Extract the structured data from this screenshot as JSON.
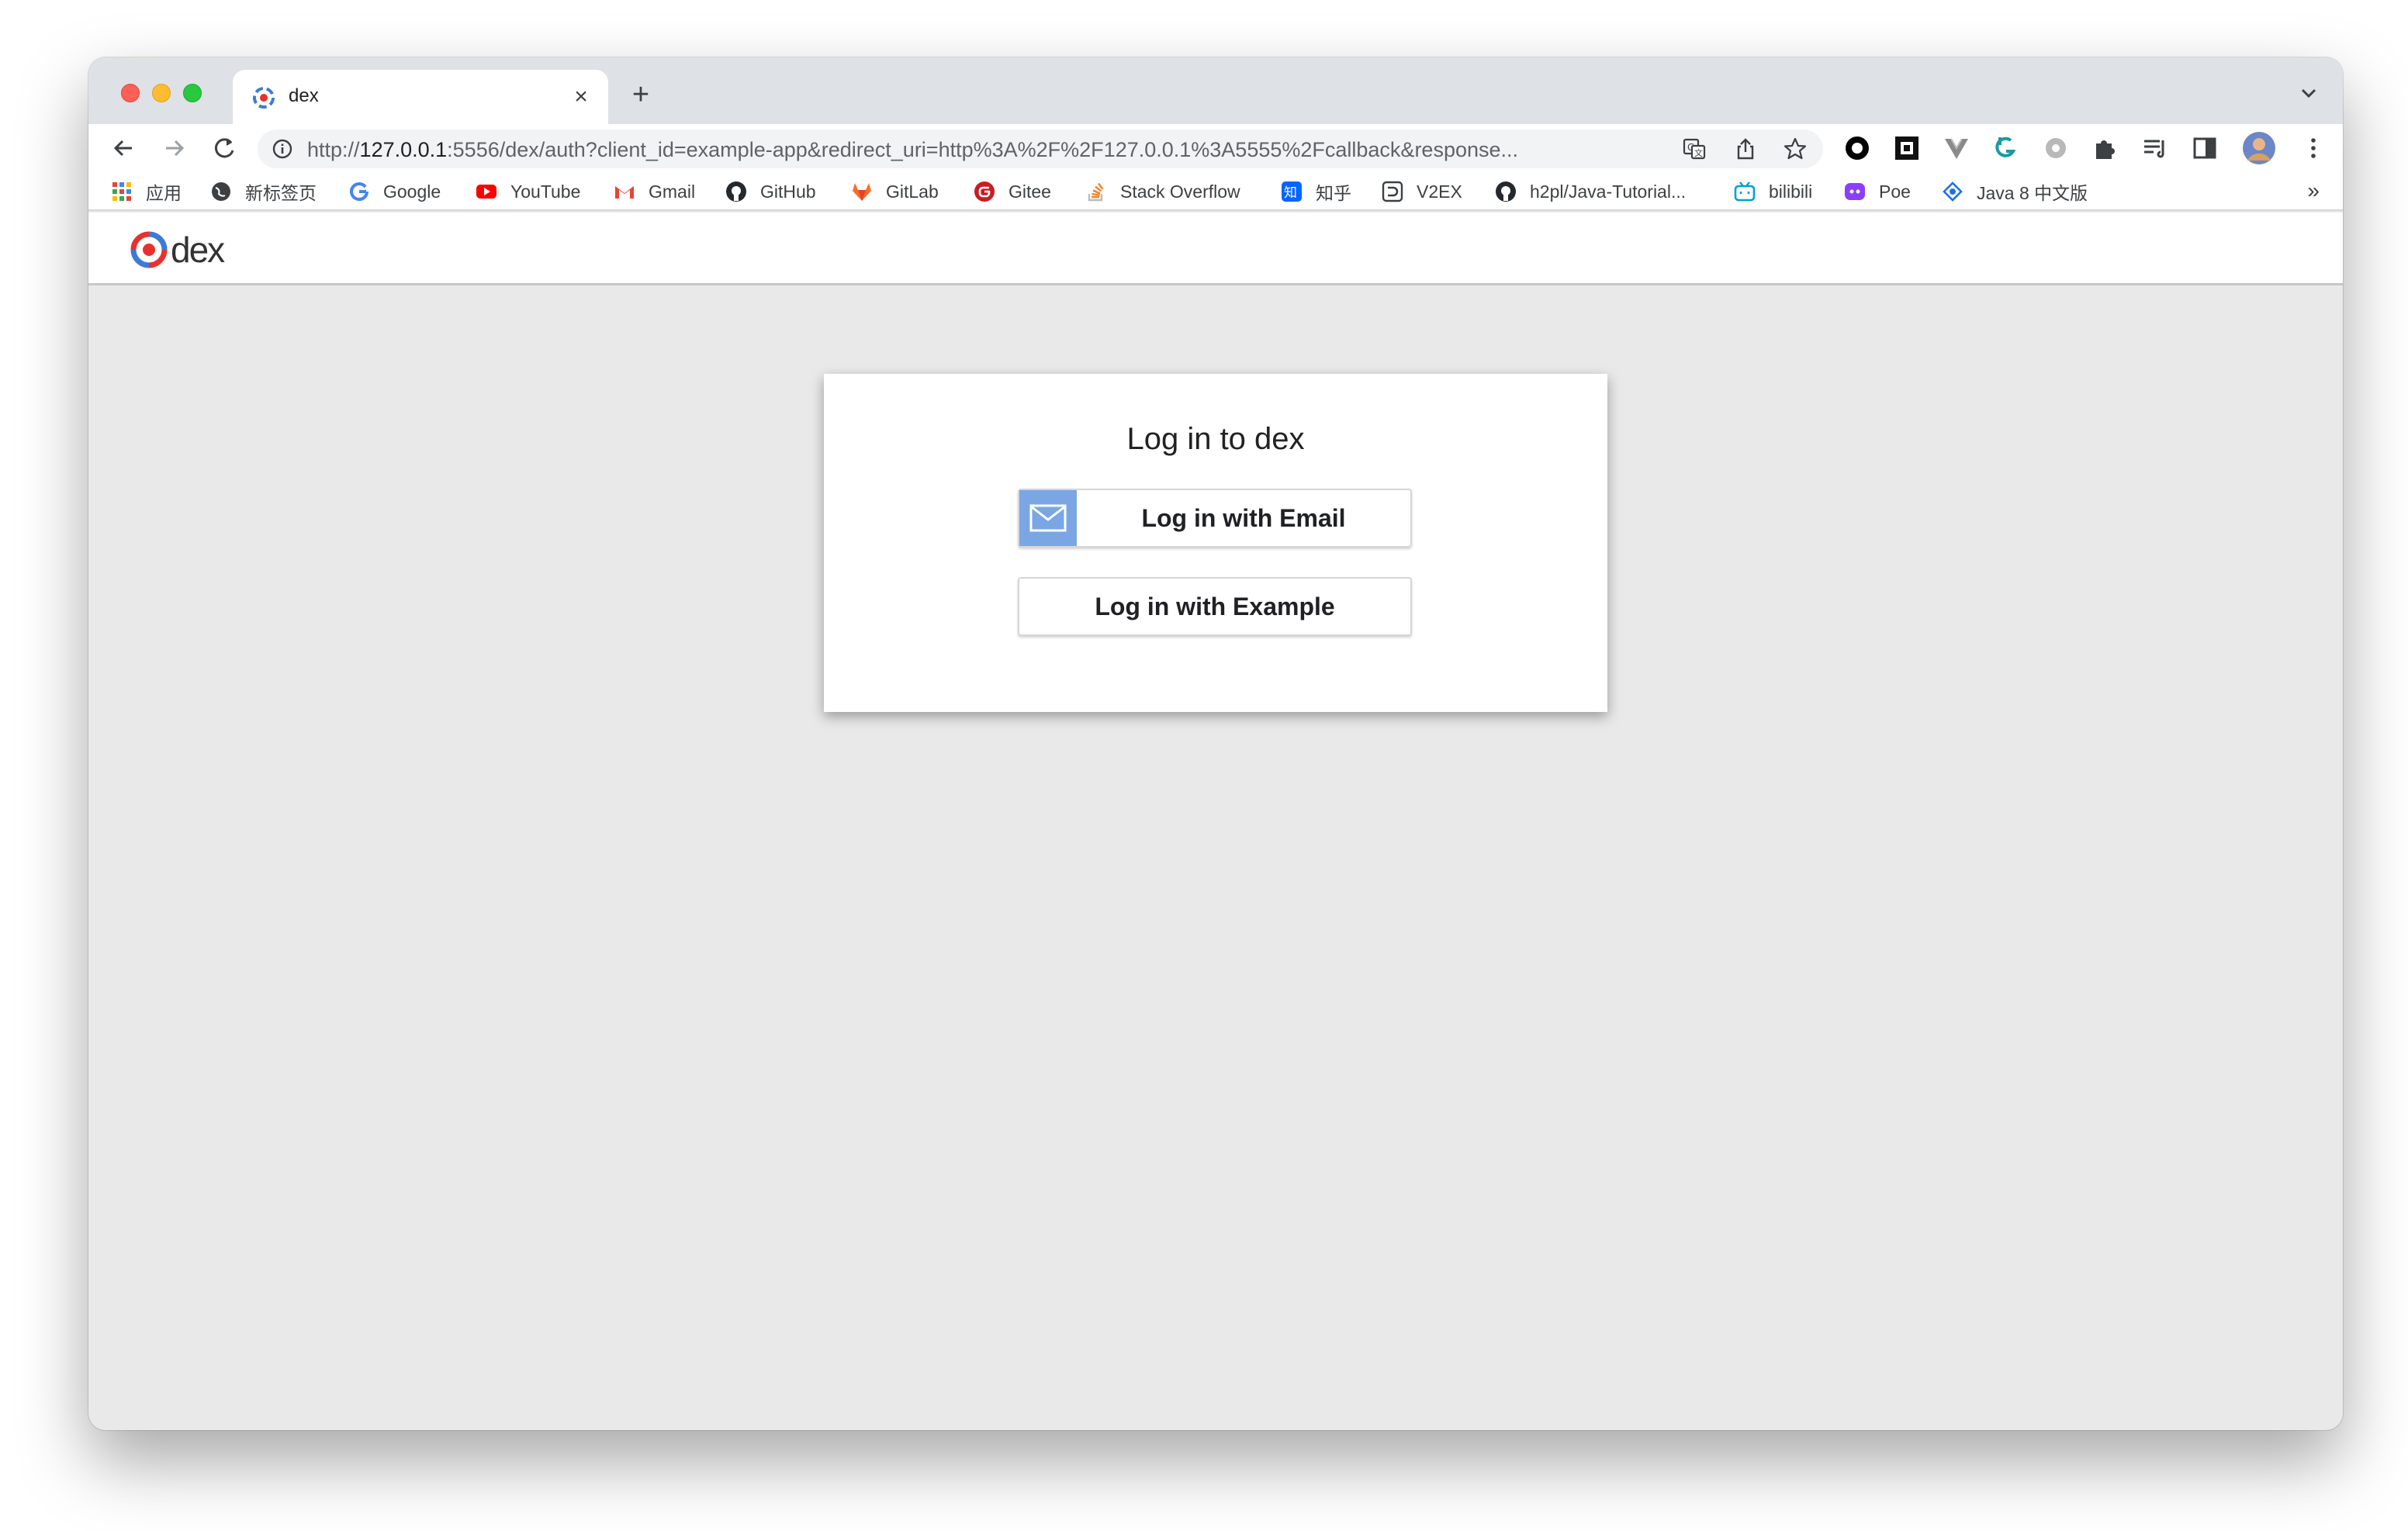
{
  "browser": {
    "tab": {
      "title": "dex",
      "favicon": "dex-logo-icon"
    },
    "omnibox": {
      "url_prefix": "http://",
      "url_host": "127.0.0.1",
      "url_rest": ":5556/dex/auth?client_id=example-app&redirect_uri=http%3A%2F%2F127.0.0.1%3A5555%2Fcallback&response..."
    },
    "bookmarks": [
      {
        "label": "应用",
        "icon": "apps-grid-icon"
      },
      {
        "label": "新标签页",
        "icon": "globe-icon"
      },
      {
        "label": "Google",
        "icon": "google-icon"
      },
      {
        "label": "YouTube",
        "icon": "youtube-icon"
      },
      {
        "label": "Gmail",
        "icon": "gmail-icon"
      },
      {
        "label": "GitHub",
        "icon": "github-icon"
      },
      {
        "label": "GitLab",
        "icon": "gitlab-icon"
      },
      {
        "label": "Gitee",
        "icon": "gitee-icon"
      },
      {
        "label": "Stack Overflow",
        "icon": "stackoverflow-icon"
      },
      {
        "label": "知乎",
        "icon": "zhihu-icon"
      },
      {
        "label": "V2EX",
        "icon": "v2ex-icon"
      },
      {
        "label": "h2pl/Java-Tutorial...",
        "icon": "github-icon"
      },
      {
        "label": "bilibili",
        "icon": "bilibili-icon"
      },
      {
        "label": "Poe",
        "icon": "poe-icon"
      },
      {
        "label": "Java 8 中文版",
        "icon": "java-icon"
      }
    ],
    "bookmarks_more": "»"
  },
  "site": {
    "logo_text": "dex"
  },
  "login": {
    "title": "Log in to dex",
    "email_button": "Log in with Email",
    "example_button": "Log in with Example"
  },
  "colors": {
    "email_icon_bg": "#7aa6e4",
    "page_bg": "#e9e9e9",
    "dex_red": "#e8312f",
    "dex_blue": "#3d7bd6"
  }
}
